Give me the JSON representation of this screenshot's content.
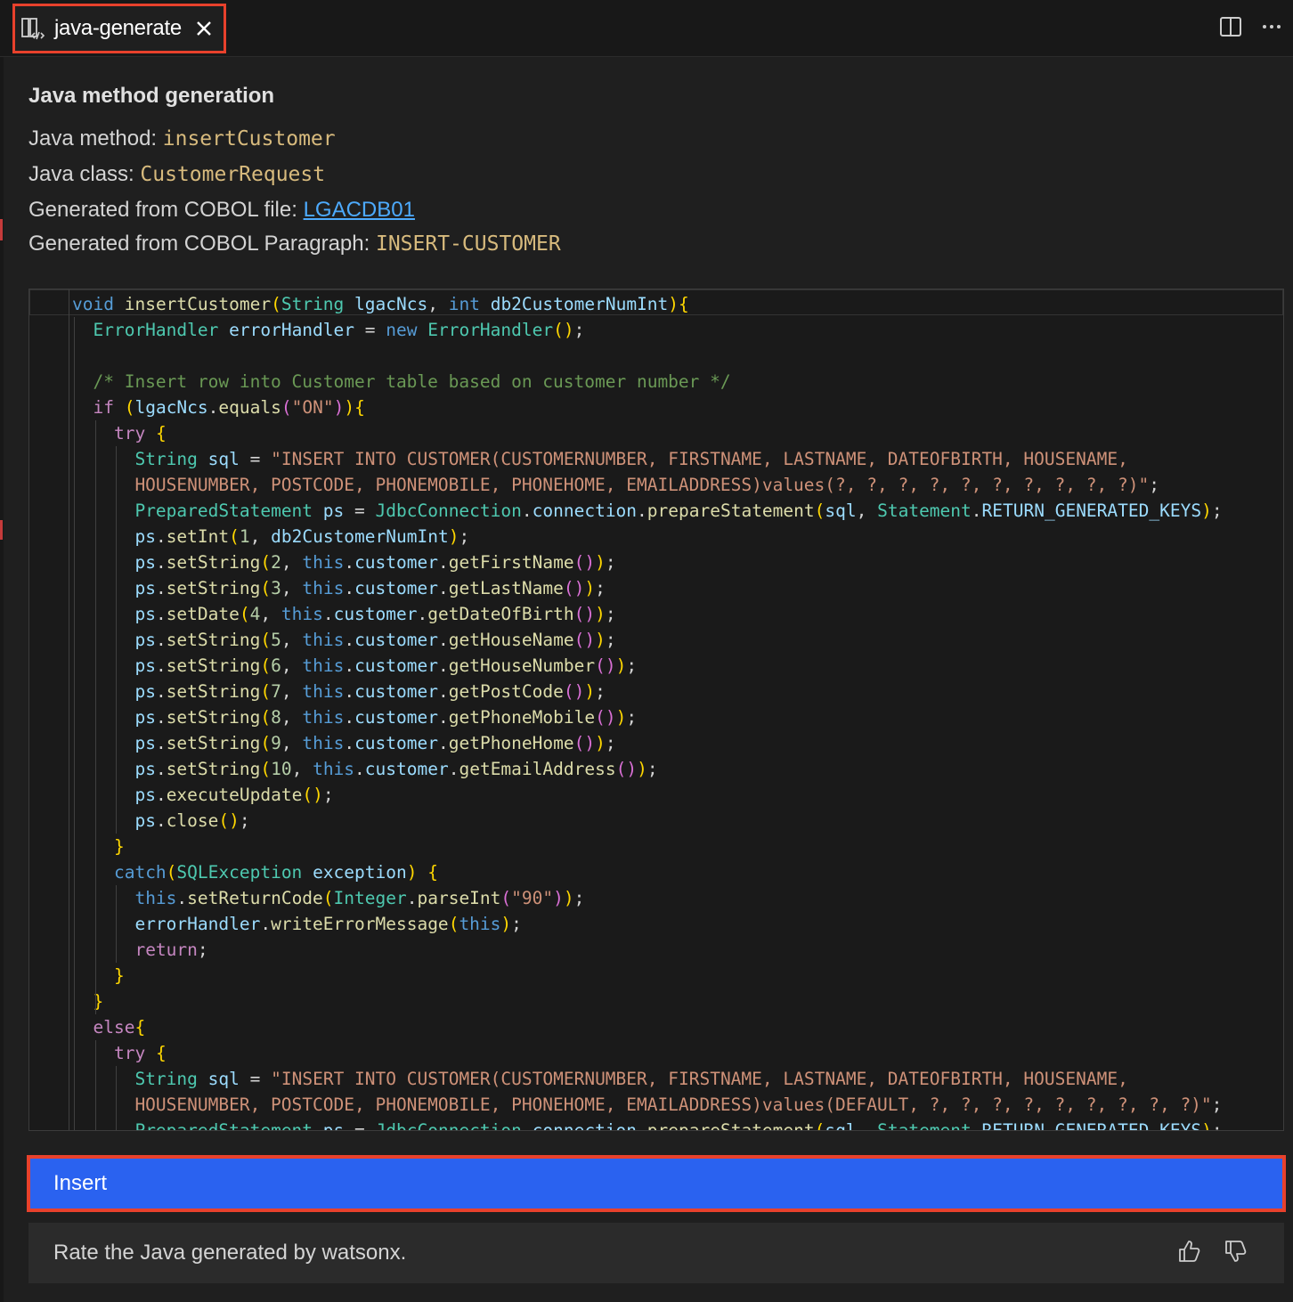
{
  "tab": {
    "label": "java-generate",
    "icon": "java-generate-file-icon"
  },
  "toolbar": {
    "split_icon": "split-editor-icon",
    "more_icon": "more-actions-icon"
  },
  "heading": "Java method generation",
  "info": {
    "method_label": "Java method: ",
    "method_value": "insertCustomer",
    "class_label": "Java class: ",
    "class_value": "CustomerRequest",
    "cobol_file_label": "Generated from COBOL file: ",
    "cobol_file_value": "LGACDB01",
    "paragraph_label": "Generated from COBOL Paragraph: ",
    "paragraph_value": "INSERT-CUSTOMER"
  },
  "code_lines": [
    "void insertCustomer(String lgacNcs, int db2CustomerNumInt){",
    "  ErrorHandler errorHandler = new ErrorHandler();",
    "",
    "  /* Insert row into Customer table based on customer number */",
    "  if (lgacNcs.equals(\"ON\")){",
    "    try {",
    "      String sql = \"INSERT INTO CUSTOMER(CUSTOMERNUMBER, FIRSTNAME, LASTNAME, DATEOFBIRTH, HOUSENAME,",
    "      HOUSENUMBER, POSTCODE, PHONEMOBILE, PHONEHOME, EMAILADDRESS)values(?, ?, ?, ?, ?, ?, ?, ?, ?, ?)\";",
    "      PreparedStatement ps = JdbcConnection.connection.prepareStatement(sql, Statement.RETURN_GENERATED_KEYS);",
    "      ps.setInt(1, db2CustomerNumInt);",
    "      ps.setString(2, this.customer.getFirstName());",
    "      ps.setString(3, this.customer.getLastName());",
    "      ps.setDate(4, this.customer.getDateOfBirth());",
    "      ps.setString(5, this.customer.getHouseName());",
    "      ps.setString(6, this.customer.getHouseNumber());",
    "      ps.setString(7, this.customer.getPostCode());",
    "      ps.setString(8, this.customer.getPhoneMobile());",
    "      ps.setString(9, this.customer.getPhoneHome());",
    "      ps.setString(10, this.customer.getEmailAddress());",
    "      ps.executeUpdate();",
    "      ps.close();",
    "    }",
    "    catch(SQLException exception) {",
    "      this.setReturnCode(Integer.parseInt(\"90\"));",
    "      errorHandler.writeErrorMessage(this);",
    "      return;",
    "    }",
    "  }",
    "  else{",
    "    try {",
    "      String sql = \"INSERT INTO CUSTOMER(CUSTOMERNUMBER, FIRSTNAME, LASTNAME, DATEOFBIRTH, HOUSENAME,",
    "      HOUSENUMBER, POSTCODE, PHONEMOBILE, PHONEHOME, EMAILADDRESS)values(DEFAULT, ?, ?, ?, ?, ?, ?, ?, ?, ?)\";",
    "      PreparedStatement ps = JdbcConnection.connection.prepareStatement(sql, Statement.RETURN_GENERATED_KEYS);"
  ],
  "insert_button": "Insert",
  "rating": {
    "text": "Rate the Java generated by watsonx.",
    "thumbs_up_icon": "thumbs-up-icon",
    "thumbs_down_icon": "thumbs-down-icon"
  }
}
